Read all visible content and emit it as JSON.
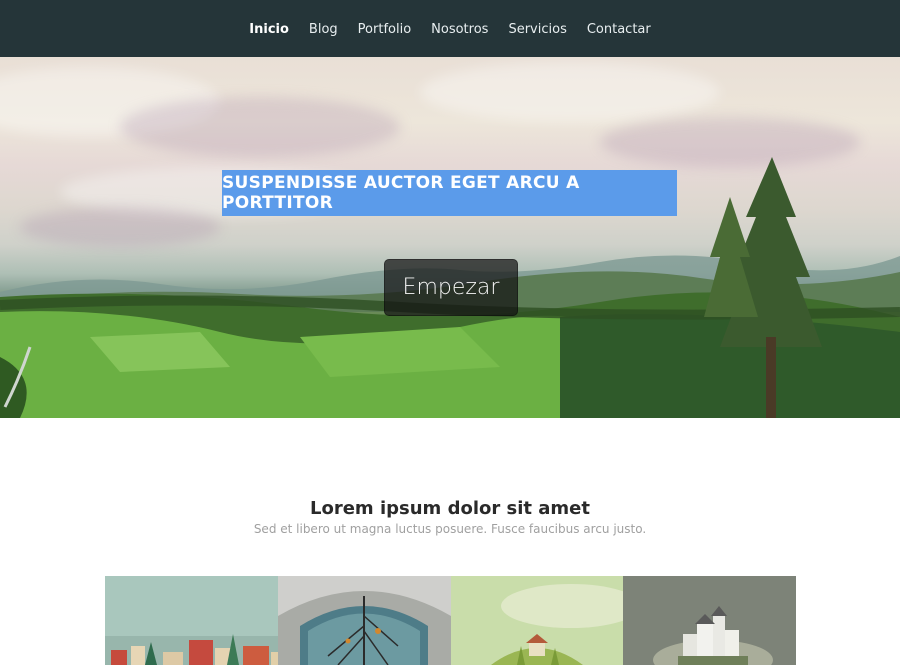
{
  "nav": {
    "items": [
      {
        "label": "Inicio",
        "active": true
      },
      {
        "label": "Blog",
        "active": false
      },
      {
        "label": "Portfolio",
        "active": false
      },
      {
        "label": "Nosotros",
        "active": false
      },
      {
        "label": "Servicios",
        "active": false
      },
      {
        "label": "Contactar",
        "active": false
      }
    ]
  },
  "hero": {
    "title": "SUSPENDISSE AUCTOR EGET ARCU A PORTTITOR",
    "button_label": "Empezar",
    "title_bg_color": "#5b9bea"
  },
  "section": {
    "title": "Lorem ipsum dolor sit amet",
    "subtitle": "Sed et libero ut magna luctus posuere. Fusce faucibus arcu justo."
  },
  "gallery": {
    "tiles": [
      {
        "name": "colorful-town-image"
      },
      {
        "name": "tree-in-arch-image"
      },
      {
        "name": "house-on-hill-image"
      },
      {
        "name": "floating-castle-image"
      }
    ]
  },
  "colors": {
    "navbar": "#253539",
    "accent": "#5b9bea"
  }
}
